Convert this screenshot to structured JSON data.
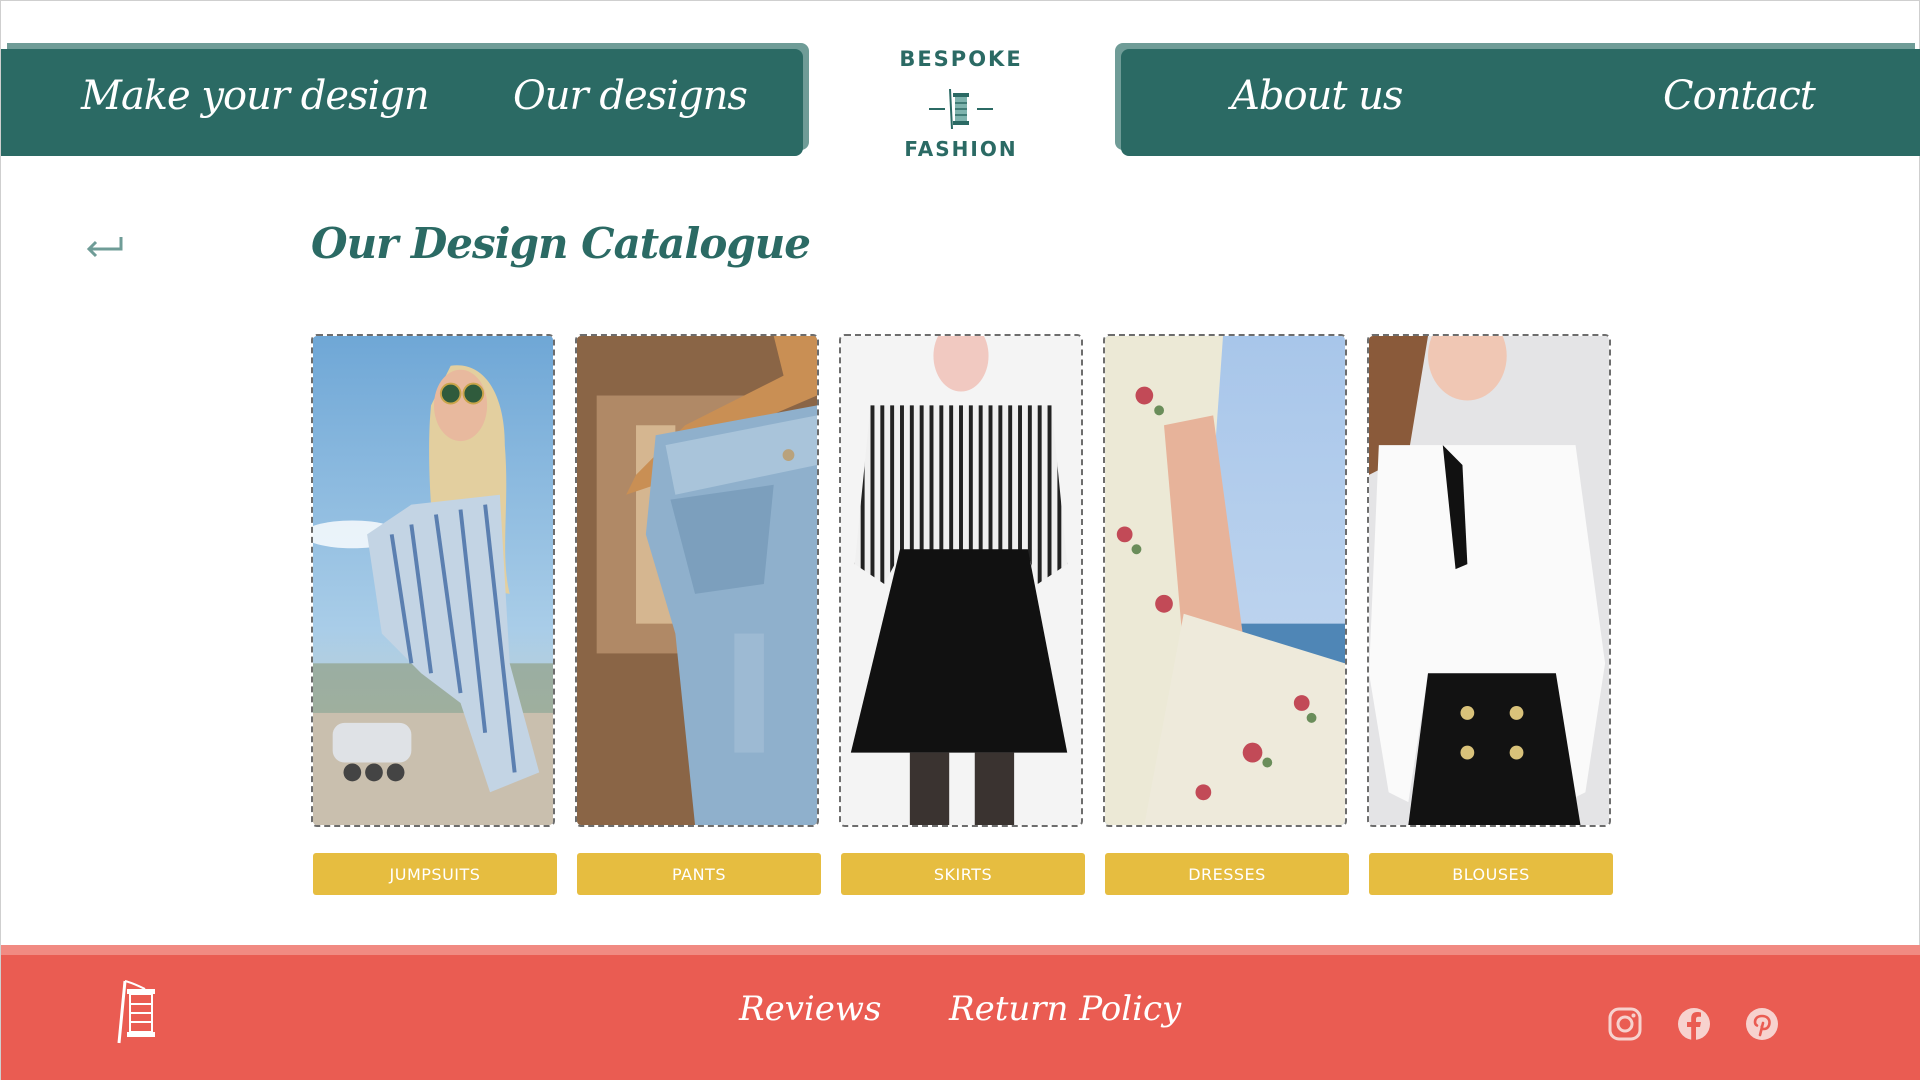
{
  "header": {
    "nav_left": [
      {
        "label": "Make your design"
      },
      {
        "label": "Our designs"
      }
    ],
    "nav_right": [
      {
        "label": "About us"
      },
      {
        "label": "Contact"
      }
    ],
    "logo": {
      "top": "BESPOKE",
      "bottom": "FASHION"
    }
  },
  "page": {
    "title": "Our Design Catalogue",
    "back_icon": "back-arrow-icon"
  },
  "categories": [
    {
      "label": "JUMPSUITS"
    },
    {
      "label": "PANTS"
    },
    {
      "label": "SKIRTS"
    },
    {
      "label": "DRESSES"
    },
    {
      "label": "BLOUSES"
    }
  ],
  "footer": {
    "links": [
      {
        "label": "Reviews"
      },
      {
        "label": "Return Policy"
      }
    ],
    "social_icons": [
      "instagram-icon",
      "facebook-icon",
      "pinterest-icon"
    ]
  },
  "colors": {
    "teal": "#2b6a64",
    "coral": "#ea5c52",
    "mustard": "#e6bd40"
  }
}
